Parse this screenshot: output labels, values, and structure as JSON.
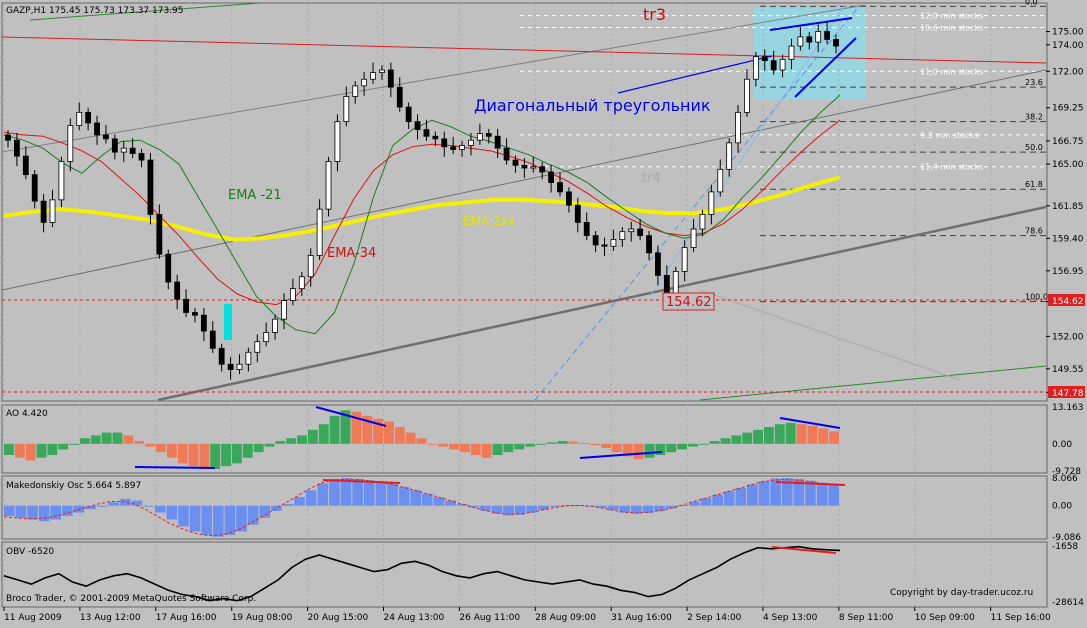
{
  "chart_data": {
    "type": "candlestick",
    "symbol_title": "GAZP,H1",
    "ohlc_header": "175.45 175.73 173.37 173.95",
    "marker_label": "tr3",
    "pattern_label": "Диагональный треугольник",
    "ema_labels": {
      "ema21": "EMA -21",
      "ema34": "EMA-34",
      "ema2xx": "EMA-2xx"
    },
    "faint_label": "tr4",
    "y_range": [
      147.2,
      177.0
    ],
    "price_ticks": [
      "175.00",
      "174.00",
      "172.00",
      "169.25",
      "166.75",
      "165.00",
      "161.85",
      "159.40",
      "156.95",
      "154.62",
      "152.00",
      "149.55",
      "147.78"
    ],
    "fib_levels": [
      {
        "label": "0.0",
        "price": 176.9
      },
      {
        "label": "23.6",
        "price": 170.8
      },
      {
        "label": "38.2",
        "price": 168.2
      },
      {
        "label": "50.0",
        "price": 165.9
      },
      {
        "label": "61.8",
        "price": 163.1
      },
      {
        "label": "78.6",
        "price": 159.6
      },
      {
        "label": "100.0",
        "price": 154.62
      }
    ],
    "stops_labels": [
      {
        "label": "12,0 min stocks",
        "price": 176.2
      },
      {
        "label": "10,6 min stocks",
        "price": 175.3
      },
      {
        "label": "11,0 min stocks",
        "price": 172.0
      },
      {
        "label": "9,3 min stocks",
        "price": 167.2
      },
      {
        "label": "11,4 min stocks",
        "price": 164.8
      }
    ],
    "low_label": "154.62",
    "current_price": "154.62",
    "low_line_price": "147.78",
    "x_labels": [
      "11 Aug 2009",
      "13 Aug 12:00",
      "17 Aug 16:00",
      "19 Aug 08:00",
      "20 Aug 15:00",
      "24 Aug 13:00",
      "26 Aug 11:00",
      "28 Aug 09:00",
      "31 Aug 16:00",
      "2 Sep 14:00",
      "4 Sep 13:00",
      "8 Sep 11:00",
      "10 Sep 09:00",
      "11 Sep 16:00"
    ],
    "closes": [
      166.8,
      165.6,
      164.2,
      162.2,
      160.6,
      162.3,
      165.2,
      167.9,
      168.9,
      168.1,
      167.2,
      166.9,
      165.9,
      166.2,
      165.8,
      165.3,
      161.2,
      158.2,
      156.1,
      154.8,
      153.8,
      153.6,
      152.4,
      151.1,
      149.9,
      149.5,
      149.9,
      150.8,
      151.6,
      152.3,
      153.3,
      154.7,
      155.6,
      156.5,
      158.1,
      161.6,
      165.2,
      168.2,
      170.1,
      170.9,
      171.4,
      171.9,
      172.1,
      170.8,
      169.3,
      168.2,
      167.6,
      167.1,
      166.9,
      166.3,
      166.1,
      166.4,
      166.8,
      167.3,
      167.1,
      166.2,
      165.3,
      164.9,
      164.7,
      164.8,
      164.4,
      163.6,
      162.9,
      161.9,
      160.6,
      159.6,
      158.9,
      158.8,
      159.3,
      159.9,
      160.1,
      159.6,
      158.3,
      156.6,
      155.2,
      156.9,
      158.7,
      160.1,
      161.2,
      162.9,
      164.6,
      166.6,
      168.9,
      171.4,
      173.1,
      172.8,
      172.1,
      172.9,
      173.9,
      174.6,
      174.2,
      175.0,
      174.4,
      173.9
    ],
    "ema21": [
      167.2,
      166.8,
      166.2,
      165.1,
      164.3,
      165.6,
      166.7,
      166.8,
      166.1,
      165.0,
      162.5,
      160.0,
      157.5,
      155.0,
      153.5,
      152.5,
      152.2,
      153.8,
      157.5,
      162.5,
      166.4,
      167.6,
      168.3,
      167.8,
      167.1,
      166.7,
      166.2,
      165.7,
      165.0,
      164.4,
      163.6,
      162.5,
      161.5,
      160.5,
      159.8,
      159.4,
      159.7,
      160.8,
      162.5,
      164.0,
      165.7,
      167.4,
      168.9,
      170.2
    ],
    "ema34": [
      167.4,
      167.2,
      167.1,
      166.6,
      166.0,
      165.2,
      163.9,
      162.6,
      161.1,
      159.6,
      157.9,
      156.3,
      155.2,
      154.6,
      154.4,
      155.0,
      156.7,
      159.6,
      162.4,
      164.5,
      165.7,
      166.3,
      166.5,
      166.4,
      166.2,
      166.0,
      165.6,
      165.1,
      164.4,
      163.7,
      162.8,
      161.8,
      161.0,
      160.3,
      159.8,
      159.6,
      159.8,
      160.5,
      161.6,
      163.0,
      164.5,
      165.9,
      167.2,
      168.3
    ],
    "ema2xx": [
      161.1,
      161.4,
      161.6,
      161.4,
      161.1,
      160.8,
      160.3,
      159.7,
      159.3,
      159.4,
      159.7,
      160.1,
      160.6,
      161.1,
      161.5,
      161.9,
      162.1,
      162.3,
      162.3,
      162.2,
      162.0,
      161.8,
      161.5,
      161.3,
      161.3,
      161.6,
      162.1,
      162.7,
      163.4,
      164.0
    ],
    "ao": {
      "label": "AO 4.420",
      "ticks": [
        "13.163",
        "0.00",
        "-9.728"
      ],
      "range": [
        -9.728,
        13.163
      ],
      "values": [
        -4,
        -5,
        -6,
        -5,
        -4,
        -2,
        0,
        2,
        3,
        4,
        4,
        3,
        1,
        -1,
        -3,
        -5,
        -7,
        -8,
        -9,
        -9,
        -8,
        -7,
        -5,
        -3,
        -1,
        1,
        2,
        3,
        5,
        7,
        10,
        12,
        11.5,
        10,
        9,
        8,
        6,
        4,
        2,
        0,
        -1,
        -2,
        -3,
        -4,
        -5,
        -4,
        -3,
        -2,
        -1,
        0,
        0.5,
        1,
        0.8,
        0.3,
        -0.5,
        -1.5,
        -3,
        -4.5,
        -5.5,
        -5,
        -4,
        -3,
        -2,
        -1,
        0,
        1,
        2,
        3,
        4,
        5,
        6,
        7,
        7.5,
        7,
        6.5,
        5.5,
        4.5
      ]
    },
    "mak": {
      "label": "Makedonskiy Osc 5.664 5.897",
      "ticks": [
        "8.066",
        "0.00",
        "-9.086"
      ],
      "range": [
        -9.086,
        8.066
      ],
      "values": [
        -3,
        -3.5,
        -4,
        -4.5,
        -4,
        -3,
        -2,
        -1,
        0,
        1,
        2,
        1.5,
        0,
        -2,
        -4,
        -6,
        -7.5,
        -8.5,
        -9,
        -8.5,
        -7.5,
        -5.5,
        -3.5,
        -1.5,
        0.5,
        2.5,
        4.5,
        6.5,
        7.8,
        8,
        7.8,
        7.4,
        7,
        6.4,
        5.5,
        4.5,
        3.5,
        2.5,
        1.5,
        0.5,
        -0.5,
        -1.5,
        -2.3,
        -2.8,
        -2.6,
        -2,
        -1.2,
        -0.3,
        0.2,
        0.2,
        0,
        -0.6,
        -1.3,
        -2,
        -2.3,
        -2.1,
        -1.6,
        -0.8,
        0.2,
        1.2,
        2.2,
        3.2,
        4.2,
        5.2,
        6.2,
        7.2,
        7.9,
        8,
        7.8,
        7.3,
        6.7,
        6.2
      ],
      "signal": [
        -3.2,
        -3.5,
        -3.8,
        -3.8,
        -3.3,
        -2.5,
        -1.5,
        -0.5,
        0.5,
        1.2,
        1.3,
        0.5,
        -1,
        -3,
        -5,
        -6.5,
        -7.8,
        -8.6,
        -8.7,
        -8.1,
        -6.8,
        -5,
        -3,
        -1,
        1,
        3,
        5,
        6.7,
        7.5,
        7.7,
        7.6,
        7.3,
        6.8,
        6.2,
        5.3,
        4.4,
        3.4,
        2.4,
        1.4,
        0.4,
        -0.6,
        -1.5,
        -2.2,
        -2.5,
        -2.3,
        -1.8,
        -1,
        -0.4,
        0,
        0.1,
        -0.2,
        -0.8,
        -1.5,
        -2,
        -2.1,
        -1.8,
        -1.2,
        -0.4,
        0.6,
        1.6,
        2.6,
        3.6,
        4.6,
        5.6,
        6.6,
        7.3,
        7.6,
        7.5,
        7.2,
        6.7,
        6.3,
        6.0
      ]
    },
    "obv": {
      "label": "OBV -6520",
      "ticks": [
        "-1658",
        "-28614"
      ],
      "range": [
        -28614,
        -1658
      ],
      "values": [
        -16,
        -18,
        -20,
        -17,
        -15,
        -19,
        -21,
        -18,
        -16,
        -15,
        -17,
        -20,
        -23,
        -25,
        -26,
        -28,
        -27,
        -28,
        -26,
        -22,
        -18,
        -12,
        -8,
        -6,
        -8,
        -10,
        -12,
        -14,
        -13,
        -10,
        -9,
        -11,
        -14,
        -16,
        -17,
        -15,
        -14,
        -16,
        -18,
        -19,
        -20,
        -19,
        -18,
        -20,
        -21,
        -23,
        -24,
        -26,
        -25,
        -22,
        -18,
        -15,
        -12,
        -8,
        -5,
        -2.5,
        -3,
        -2.5,
        -2,
        -3,
        -3.5,
        -3.8
      ],
      "values_scale": 1000
    },
    "footer_left": "Broco Trader, © 2001-2009 MetaQuotes Software Corp.",
    "footer_right": "Copyright by day-trader.ucoz.ru"
  }
}
